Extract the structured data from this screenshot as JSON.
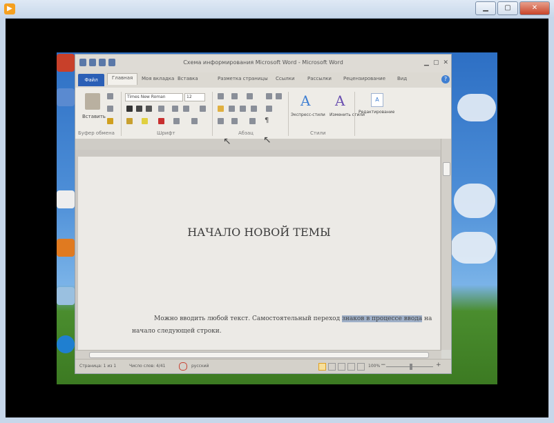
{
  "word": {
    "title": "Схема информирования  Microsoft Word  - Microsoft Word",
    "tabs": [
      {
        "label": "Файл"
      },
      {
        "label": "Главная"
      },
      {
        "label": "Моя вкладка"
      },
      {
        "label": "Вставка"
      },
      {
        "label": "Разметка страницы"
      },
      {
        "label": "Ссылки"
      },
      {
        "label": "Рассылки"
      },
      {
        "label": "Рецензирование"
      },
      {
        "label": "Вид"
      }
    ],
    "ribbon": {
      "font_name": "Times New Roman",
      "font_size": "12",
      "paste_label": "Вставить",
      "express_styles_label": "Экспресс-стили",
      "change_styles_label": "Изменить стили",
      "editing_label": "Редактирование",
      "groups": [
        "Буфер обмена",
        "Шрифт",
        "Абзац",
        "Стили"
      ]
    },
    "document": {
      "heading": "НАЧАЛО НОВОЙ ТЕМЫ",
      "para_line1_before": "Можно вводить любой текст. Самостоятельный переход ",
      "para_line1_highlight": "знаков в процессе ввода",
      "para_line1_after": " на",
      "para_line2": "начало следующей строки."
    },
    "status": {
      "page": "Страница: 1 из 1",
      "words": "Число слов: 4/41",
      "language": "русский",
      "zoom": "100%",
      "zoom_minus": "−",
      "zoom_plus": "+"
    }
  },
  "icons": [
    "player-logo-icon",
    "minimize-icon",
    "maximize-icon",
    "close-icon",
    "save-icon",
    "undo-icon",
    "help-icon"
  ]
}
